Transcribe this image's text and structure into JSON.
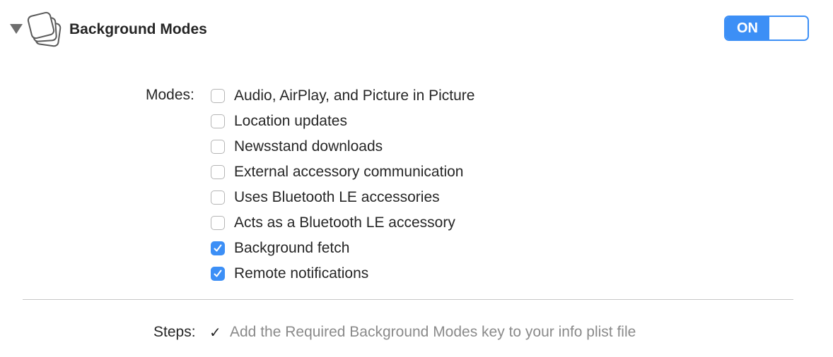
{
  "capability": {
    "title": "Background Modes",
    "icon": "background-modes-icon",
    "toggle_label": "ON",
    "enabled": true,
    "accent_color": "#3c8ff6"
  },
  "modes": {
    "label": "Modes:",
    "items": [
      {
        "label": "Audio, AirPlay, and Picture in Picture",
        "checked": false
      },
      {
        "label": "Location updates",
        "checked": false
      },
      {
        "label": "Newsstand downloads",
        "checked": false
      },
      {
        "label": "External accessory communication",
        "checked": false
      },
      {
        "label": "Uses Bluetooth LE accessories",
        "checked": false
      },
      {
        "label": "Acts as a Bluetooth LE accessory",
        "checked": false
      },
      {
        "label": "Background fetch",
        "checked": true
      },
      {
        "label": "Remote notifications",
        "checked": true
      }
    ]
  },
  "steps": {
    "label": "Steps:",
    "items": [
      {
        "status_icon": "checkmark-icon",
        "status_glyph": "✓",
        "text": "Add the Required Background Modes key to your info plist file"
      }
    ]
  }
}
